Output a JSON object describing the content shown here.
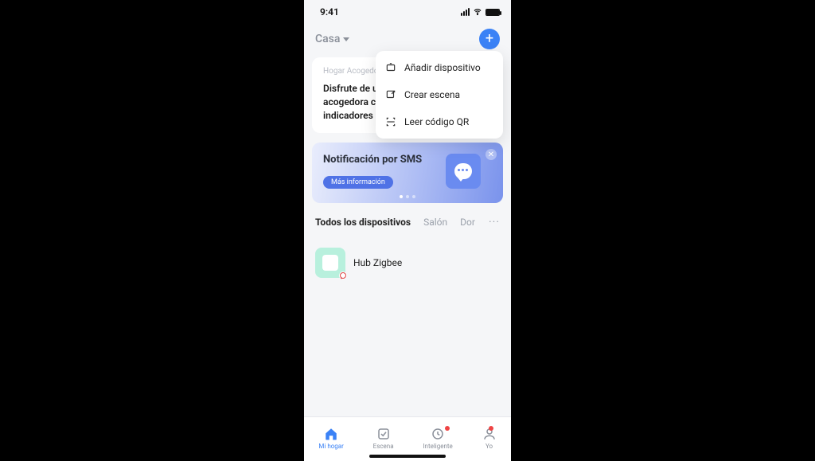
{
  "status": {
    "time": "9:41"
  },
  "header": {
    "home_label": "Casa"
  },
  "dropdown": {
    "items": [
      {
        "label": "Añadir dispositivo"
      },
      {
        "label": "Crear escena"
      },
      {
        "label": "Leer código QR"
      }
    ]
  },
  "card": {
    "tag": "Hogar Acogedor",
    "line1": "Disfrute de una vida hogareña",
    "line2": "acogedora con los tres principales",
    "line3": "indicadores ambientales"
  },
  "banner": {
    "title": "Notificación por SMS",
    "pill": "Más información"
  },
  "device_tabs": {
    "all": "Todos los dispositivos",
    "room1": "Salón",
    "room2": "Dor"
  },
  "devices": [
    {
      "name": "Hub Zigbee"
    }
  ],
  "tabbar": {
    "home": "Mi hogar",
    "scene": "Escena",
    "smart": "Inteligente",
    "me": "Yo"
  }
}
